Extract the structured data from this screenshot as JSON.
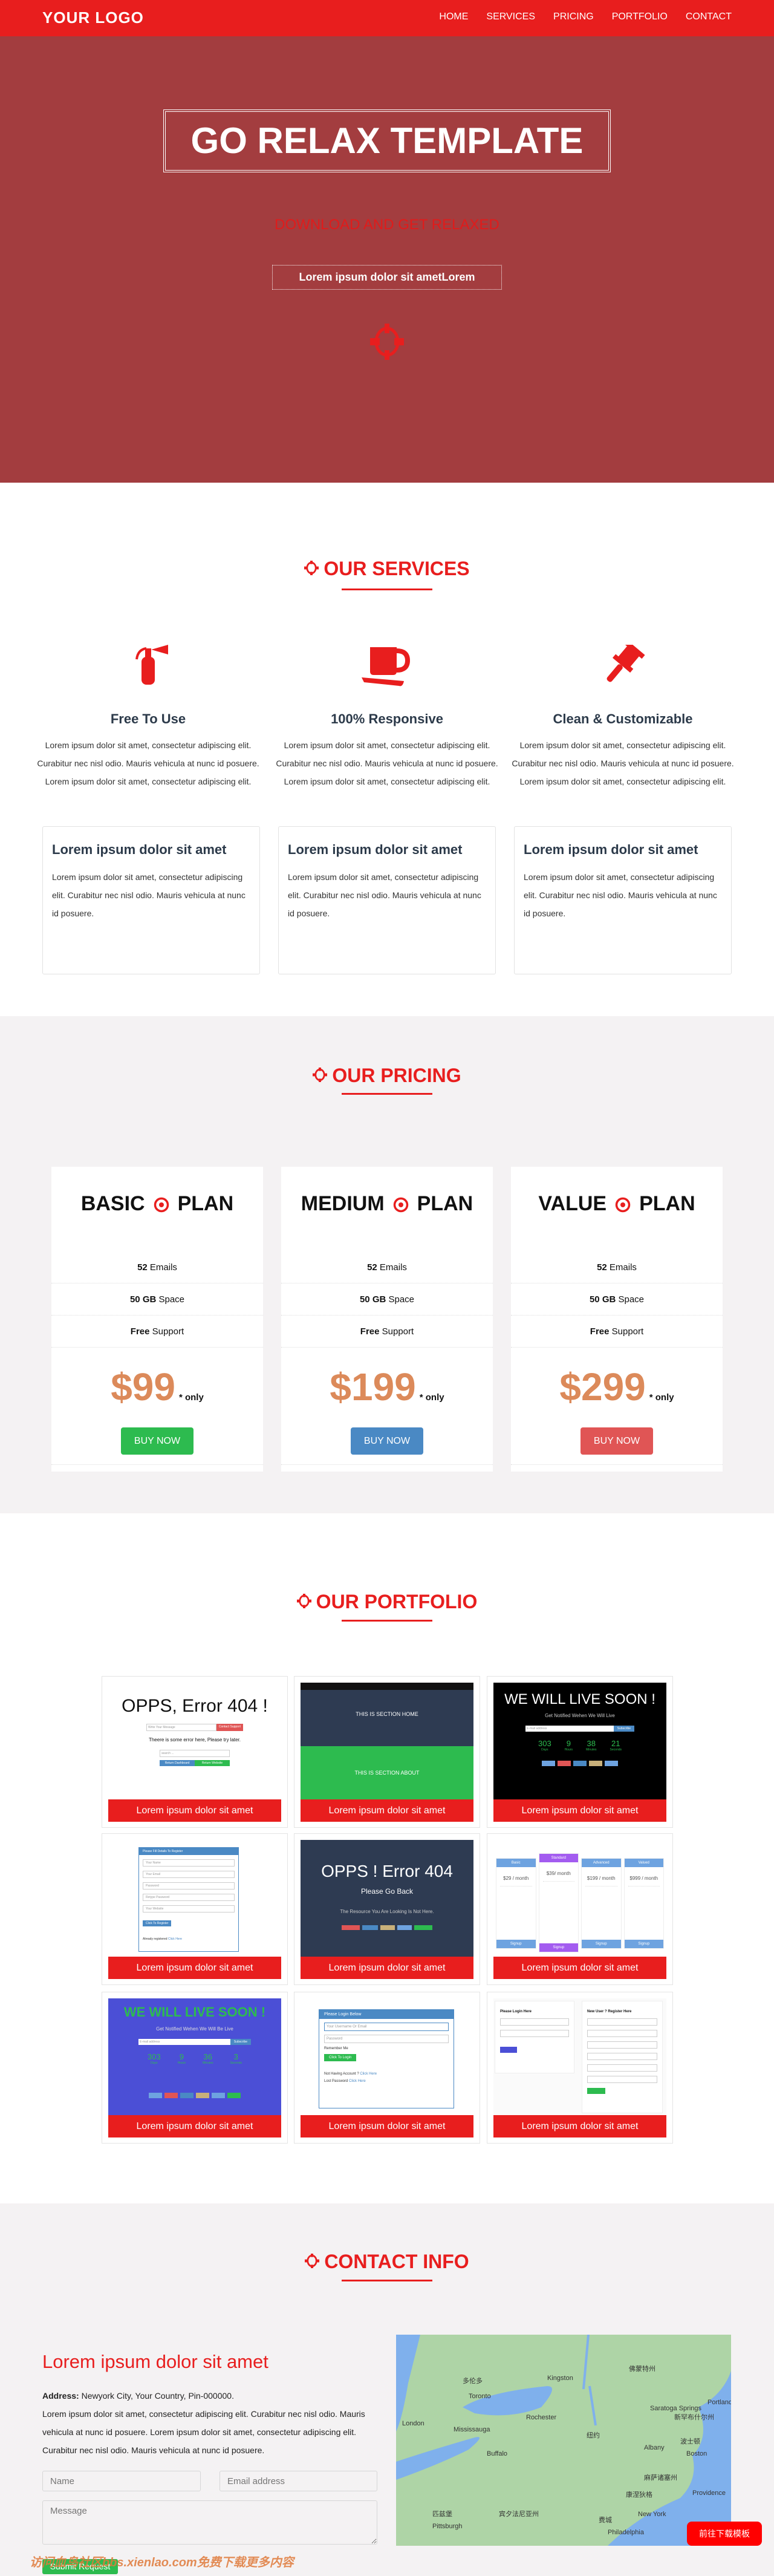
{
  "header": {
    "logo": "YOUR LOGO",
    "nav": [
      "HOME",
      "SERVICES",
      "PRICING",
      "PORTFOLIO",
      "CONTACT"
    ]
  },
  "hero": {
    "title": "GO RELAX TEMPLATE",
    "subtitle": "DOWNLOAD AND GET RELAXED",
    "button": "Lorem ipsum dolor sit ametLorem",
    "icon": "crosshairs-icon"
  },
  "colors": {
    "accent": "#e81e1e",
    "hero_bg": "#a33d3f",
    "section_bg": "#f4f2f3",
    "price": "#dc8a5a",
    "green": "#2dbb4f",
    "blue": "#4a89c4",
    "red_btn": "#e05555"
  },
  "services": {
    "title": "OUR SERVICES",
    "items": [
      {
        "icon": "fire-extinguisher-icon",
        "title": "Free To Use",
        "text": "Lorem ipsum dolor sit amet, consectetur adipiscing elit. Curabitur nec nisl odio. Mauris vehicula at nunc id posuere. Lorem ipsum dolor sit amet, consectetur adipiscing elit."
      },
      {
        "icon": "coffee-cup-icon",
        "title": "100% Responsive",
        "text": "Lorem ipsum dolor sit amet, consectetur adipiscing elit. Curabitur nec nisl odio. Mauris vehicula at nunc id posuere. Lorem ipsum dolor sit amet, consectetur adipiscing elit."
      },
      {
        "icon": "gavel-icon",
        "title": "Clean & Customizable",
        "text": "Lorem ipsum dolor sit amet, consectetur adipiscing elit. Curabitur nec nisl odio. Mauris vehicula at nunc id posuere. Lorem ipsum dolor sit amet, consectetur adipiscing elit."
      }
    ],
    "cards": [
      {
        "title": "Lorem ipsum dolor sit amet",
        "text": "Lorem ipsum dolor sit amet, consectetur adipiscing elit. Curabitur nec nisl odio. Mauris vehicula at nunc id posuere."
      },
      {
        "title": "Lorem ipsum dolor sit amet",
        "text": "Lorem ipsum dolor sit amet, consectetur adipiscing elit. Curabitur nec nisl odio. Mauris vehicula at nunc id posuere."
      },
      {
        "title": "Lorem ipsum dolor sit amet",
        "text": "Lorem ipsum dolor sit amet, consectetur adipiscing elit. Curabitur nec nisl odio. Mauris vehicula at nunc id posuere."
      }
    ]
  },
  "pricing": {
    "title": "OUR PRICING",
    "plans": [
      {
        "name": "BASIC",
        "suffix": "PLAN",
        "emails_n": "52",
        "emails": " Emails",
        "space_n": "50 GB",
        "space": " Space",
        "support_n": "Free",
        "support": " Support",
        "price": "$99",
        "only": "* only",
        "button": "BUY NOW",
        "btn_color": "#2dbb4f"
      },
      {
        "name": "MEDIUM",
        "suffix": "PLAN",
        "emails_n": "52",
        "emails": " Emails",
        "space_n": "50 GB",
        "space": " Space",
        "support_n": "Free",
        "support": " Support",
        "price": "$199",
        "only": "* only",
        "button": "BUY NOW",
        "btn_color": "#4a89c4"
      },
      {
        "name": "VALUE",
        "suffix": "PLAN",
        "emails_n": "52",
        "emails": " Emails",
        "space_n": "50 GB",
        "space": " Space",
        "support_n": "Free",
        "support": " Support",
        "price": "$299",
        "only": "* only",
        "button": "BUY NOW",
        "btn_color": "#e05555"
      }
    ]
  },
  "portfolio": {
    "title": "OUR PORTFOLIO",
    "caption": "Lorem ipsum dolor sit amet",
    "thumbs": {
      "t1": {
        "title": "OPPS, Error 404 !",
        "input": "Write Your Message",
        "btn": "Contact Support",
        "msg": "Theere is some error here, Please try later.",
        "search": "search ...",
        "b1": "Return Dashboard",
        "b2": "Return Website"
      },
      "t2": {
        "home": "THIS IS SECTION HOME",
        "about": "THIS IS SECTION ABOUT"
      },
      "t3": {
        "title": "WE WILL LIVE SOON !",
        "sub": "Get Notified Wehen We Will Live",
        "input": "E-mail address",
        "btn": "Subscribe",
        "counts": [
          "303",
          "9",
          "38",
          "21"
        ],
        "units": [
          "Days",
          "Hours",
          "Minutes",
          "Seconds"
        ]
      },
      "t4": {
        "head": "Please Fill Details To Register",
        "fields": [
          "Your Name",
          "Your Email",
          "Password",
          "Retype Password",
          "Your Website"
        ],
        "btn": "Click To Register",
        "note": "Already registered ",
        "link": "Click Here"
      },
      "t5": {
        "title": "OPPS ! Error 404",
        "sub": "Please Go Back",
        "msg": "The Resource You Are Looking Is Not Here."
      },
      "t6": {
        "plans": [
          "Basic",
          "Standard",
          "Advanced",
          "Valued"
        ],
        "prices": [
          "$29 / month",
          "$39/ month",
          "$199 / month",
          "$999 / month"
        ],
        "btn": "Signup"
      },
      "t7": {
        "title": "WE WILL LIVE SOON !",
        "sub": "Get Notified Wehen We Will Be Live",
        "input": "E-mail address",
        "btn": "Subscribe",
        "counts": [
          "303",
          "9",
          "36",
          "3"
        ],
        "units": [
          "Days",
          "Hours",
          "Minutes",
          "Seconds"
        ]
      },
      "t8": {
        "head": "Please Login Below",
        "user": "Your Username Or Email",
        "pass": "Password",
        "remember": "Remember Me",
        "btn": "Click To Login",
        "q1": "Not Having Account ? ",
        "q2": "Lost Password ",
        "link": "Click Here"
      },
      "t9": {
        "login": "Please Login Here",
        "register": "New User ? Register Here"
      }
    }
  },
  "contact": {
    "title": "CONTACT INFO",
    "heading": "Lorem ipsum dolor sit amet",
    "address_label": "Address:",
    "address": "Newyork City, Your Country, Pin-000000.",
    "text": "Lorem ipsum dolor sit amet, consectetur adipiscing elit. Curabitur nec nisl odio. Mauris vehicula at nunc id posuere. Lorem ipsum dolor sit amet, consectetur adipiscing elit. Curabitur nec nisl odio. Mauris vehicula at nunc id posuere.",
    "name_ph": "Name",
    "email_ph": "Email address",
    "message_ph": "Message",
    "submit": "Submit Request",
    "map_labels": [
      "Toronto",
      "Kingston",
      "Mississauga",
      "Rochester",
      "Buffalo",
      "Albany",
      "Boston",
      "Providence",
      "New York",
      "Philadelphia",
      "Pittsburgh",
      "Portland",
      "London",
      "Saratoga Springs",
      "多伦多",
      "纽约",
      "波士顿",
      "费城",
      "匹兹堡",
      "宾夕法尼亚州",
      "佛蒙特州",
      "新罕布什尔州",
      "麻萨诸塞州",
      "康涅狄格"
    ]
  },
  "floating_button": "前往下载模板",
  "watermark": "访问血鸟社区bbs.xienlao.com免费下载更多内容"
}
